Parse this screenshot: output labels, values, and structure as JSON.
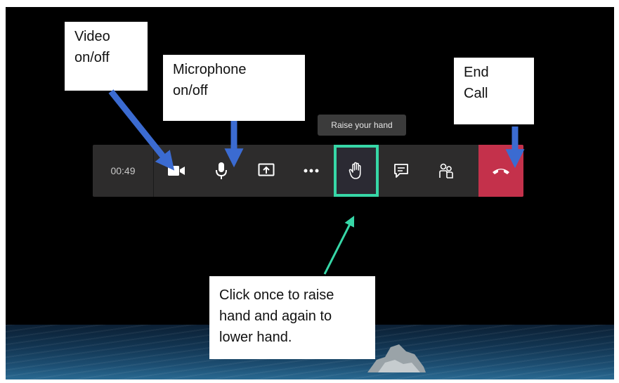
{
  "meeting_bar": {
    "timer": "00:49",
    "tooltip": "Raise your hand",
    "buttons": [
      {
        "name": "video",
        "icon": "video-camera-icon"
      },
      {
        "name": "microphone",
        "icon": "microphone-icon"
      },
      {
        "name": "share",
        "icon": "share-screen-icon"
      },
      {
        "name": "more",
        "icon": "more-options-icon"
      },
      {
        "name": "raise-hand",
        "icon": "raised-hand-icon"
      },
      {
        "name": "chat",
        "icon": "chat-icon"
      },
      {
        "name": "participants",
        "icon": "participants-icon"
      },
      {
        "name": "end-call",
        "icon": "phone-hangup-icon"
      }
    ]
  },
  "callouts": {
    "video": [
      "Video",
      "on/off"
    ],
    "microphone": [
      "Microphone",
      "on/off"
    ],
    "end_call": [
      "End",
      "Call"
    ],
    "raise_hand": [
      "Click once to raise",
      "hand and again to",
      "lower hand."
    ]
  },
  "colors": {
    "toolbar": "#2d2c2c",
    "hangup": "#c4314b",
    "highlight": "#37d7a7",
    "callout_arrow": "#3b6bd1",
    "raise_arrow": "#37d7a7"
  }
}
